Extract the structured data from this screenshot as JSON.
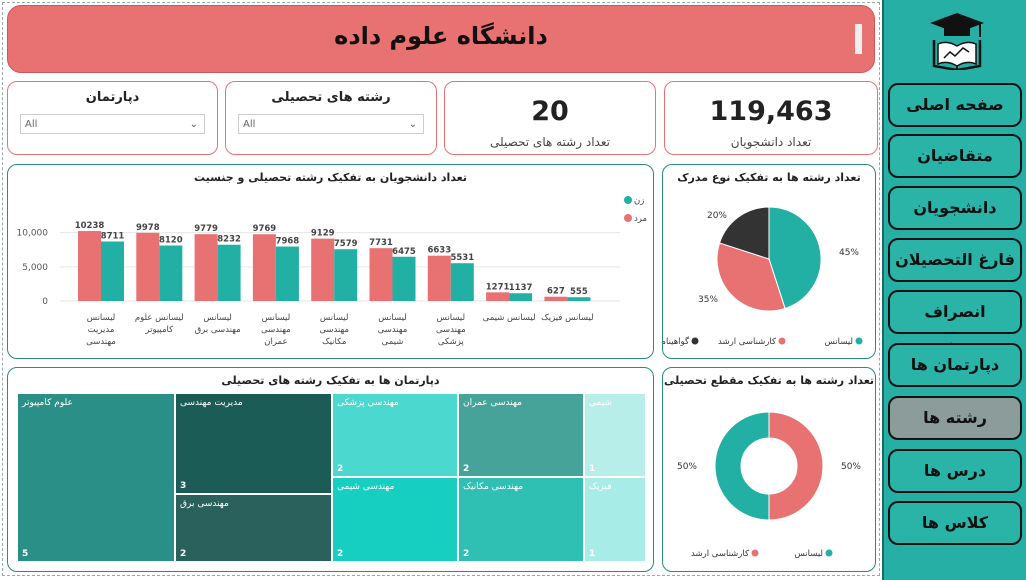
{
  "header": {
    "title": "دانشگاه علوم داده"
  },
  "slicers": [
    {
      "label": "دپارتمان",
      "value": "All"
    },
    {
      "label": "رشته های تحصیلی",
      "value": "All"
    }
  ],
  "kpis": [
    {
      "value": "20",
      "label": "تعداد رشته های تحصیلی"
    },
    {
      "value": "119,463",
      "label": "تعداد دانشجویان"
    }
  ],
  "nav": {
    "items": [
      {
        "label": "صفحه اصلی",
        "active": false
      },
      {
        "label": "متقاضیان",
        "active": false
      },
      {
        "label": "دانشجویان",
        "active": false
      },
      {
        "label": "فارغ التحصیلان",
        "active": false
      },
      {
        "label": "انصراف دهندگان",
        "active": false
      },
      {
        "label": "دپارتمان ها",
        "active": false
      },
      {
        "label": "رشته ها",
        "active": true
      },
      {
        "label": "درس ها",
        "active": false
      },
      {
        "label": "کلاس ها",
        "active": false
      }
    ]
  },
  "colors": {
    "female": "#23b0a4",
    "male": "#e87272",
    "phd": "#333333",
    "accent": "#2a8a80"
  },
  "chart_data": [
    {
      "type": "bar",
      "title": "تعداد دانشجویان به تفکیک رشته تحصیلی و جنسیت",
      "categories": [
        "لیسانس مدیریت مهندسی",
        "لیسانس علوم کامپیوتر",
        "لیسانس مهندسی برق",
        "لیسانس مهندسی عمران",
        "لیسانس مهندسی مکانیک",
        "لیسانس مهندسی شیمی",
        "لیسانس مهندسی پزشکی",
        "لیسانس شیمی",
        "لیسانس فیزیک"
      ],
      "series": [
        {
          "name": "مرد",
          "values": [
            10238,
            9978,
            9779,
            9769,
            9129,
            7731,
            6633,
            1271,
            627
          ]
        },
        {
          "name": "زن",
          "values": [
            8711,
            8120,
            8232,
            7968,
            7579,
            6475,
            5531,
            1137,
            555
          ]
        }
      ],
      "yticks": [
        "10,000",
        "5,000",
        "0"
      ],
      "ylim": [
        0,
        12000
      ],
      "legend": "top-right"
    },
    {
      "type": "pie",
      "title": "تعداد رشته ها به تفکیک نوع مدرک",
      "slices": [
        {
          "name": "لیسانس",
          "value": 45,
          "label": "45%"
        },
        {
          "name": "کارشناسی ارشد",
          "value": 35,
          "label": "35%"
        },
        {
          "name": "گواهینامه",
          "value": 20,
          "label": "20%"
        }
      ],
      "legend": "bottom"
    },
    {
      "type": "pie",
      "title": "تعداد رشته ها به تفکیک مقطع تحصیلی",
      "slices": [
        {
          "name": "لیسانس",
          "value": 50,
          "label": "50%"
        },
        {
          "name": "کارشناسی ارشد",
          "value": 50,
          "label": "50%"
        }
      ],
      "legend": "bottom"
    }
  ],
  "treemap": {
    "title": "دپارتمان ها به تفکیک رشته های تحصیلی",
    "cells": [
      {
        "label": "علوم کامپیوتر",
        "count": "5"
      },
      {
        "label": "مدیریت مهندسی",
        "count": "3"
      },
      {
        "label": "مهندسی برق",
        "count": "2"
      },
      {
        "label": "مهندسی پزشکی",
        "count": "2"
      },
      {
        "label": "مهندسی شیمی",
        "count": "2"
      },
      {
        "label": "مهندسی عمران",
        "count": "2"
      },
      {
        "label": "مهندسی مکانیک",
        "count": "2"
      },
      {
        "label": "شیمی",
        "count": "1"
      },
      {
        "label": "فیزیک",
        "count": "1"
      }
    ]
  }
}
